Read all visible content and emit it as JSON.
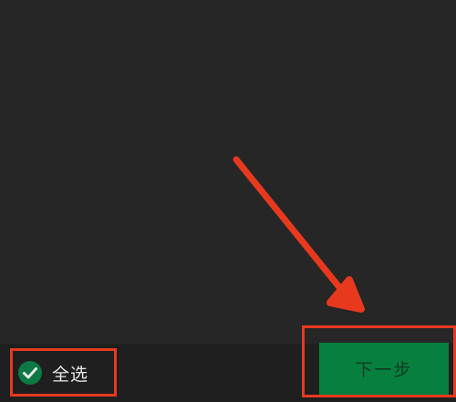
{
  "bottom_bar": {
    "select_all_label": "全选",
    "select_all_icon": "check-circle-icon",
    "next_button_label": "下一步"
  },
  "colors": {
    "background": "#262626",
    "bottom_bar": "#1f1f1f",
    "accent_green": "#07c160",
    "check_circle": "#0b7a43",
    "next_button_bg": "#07803f",
    "next_button_text": "#0a3a20",
    "annotation_red": "#e8391f"
  }
}
